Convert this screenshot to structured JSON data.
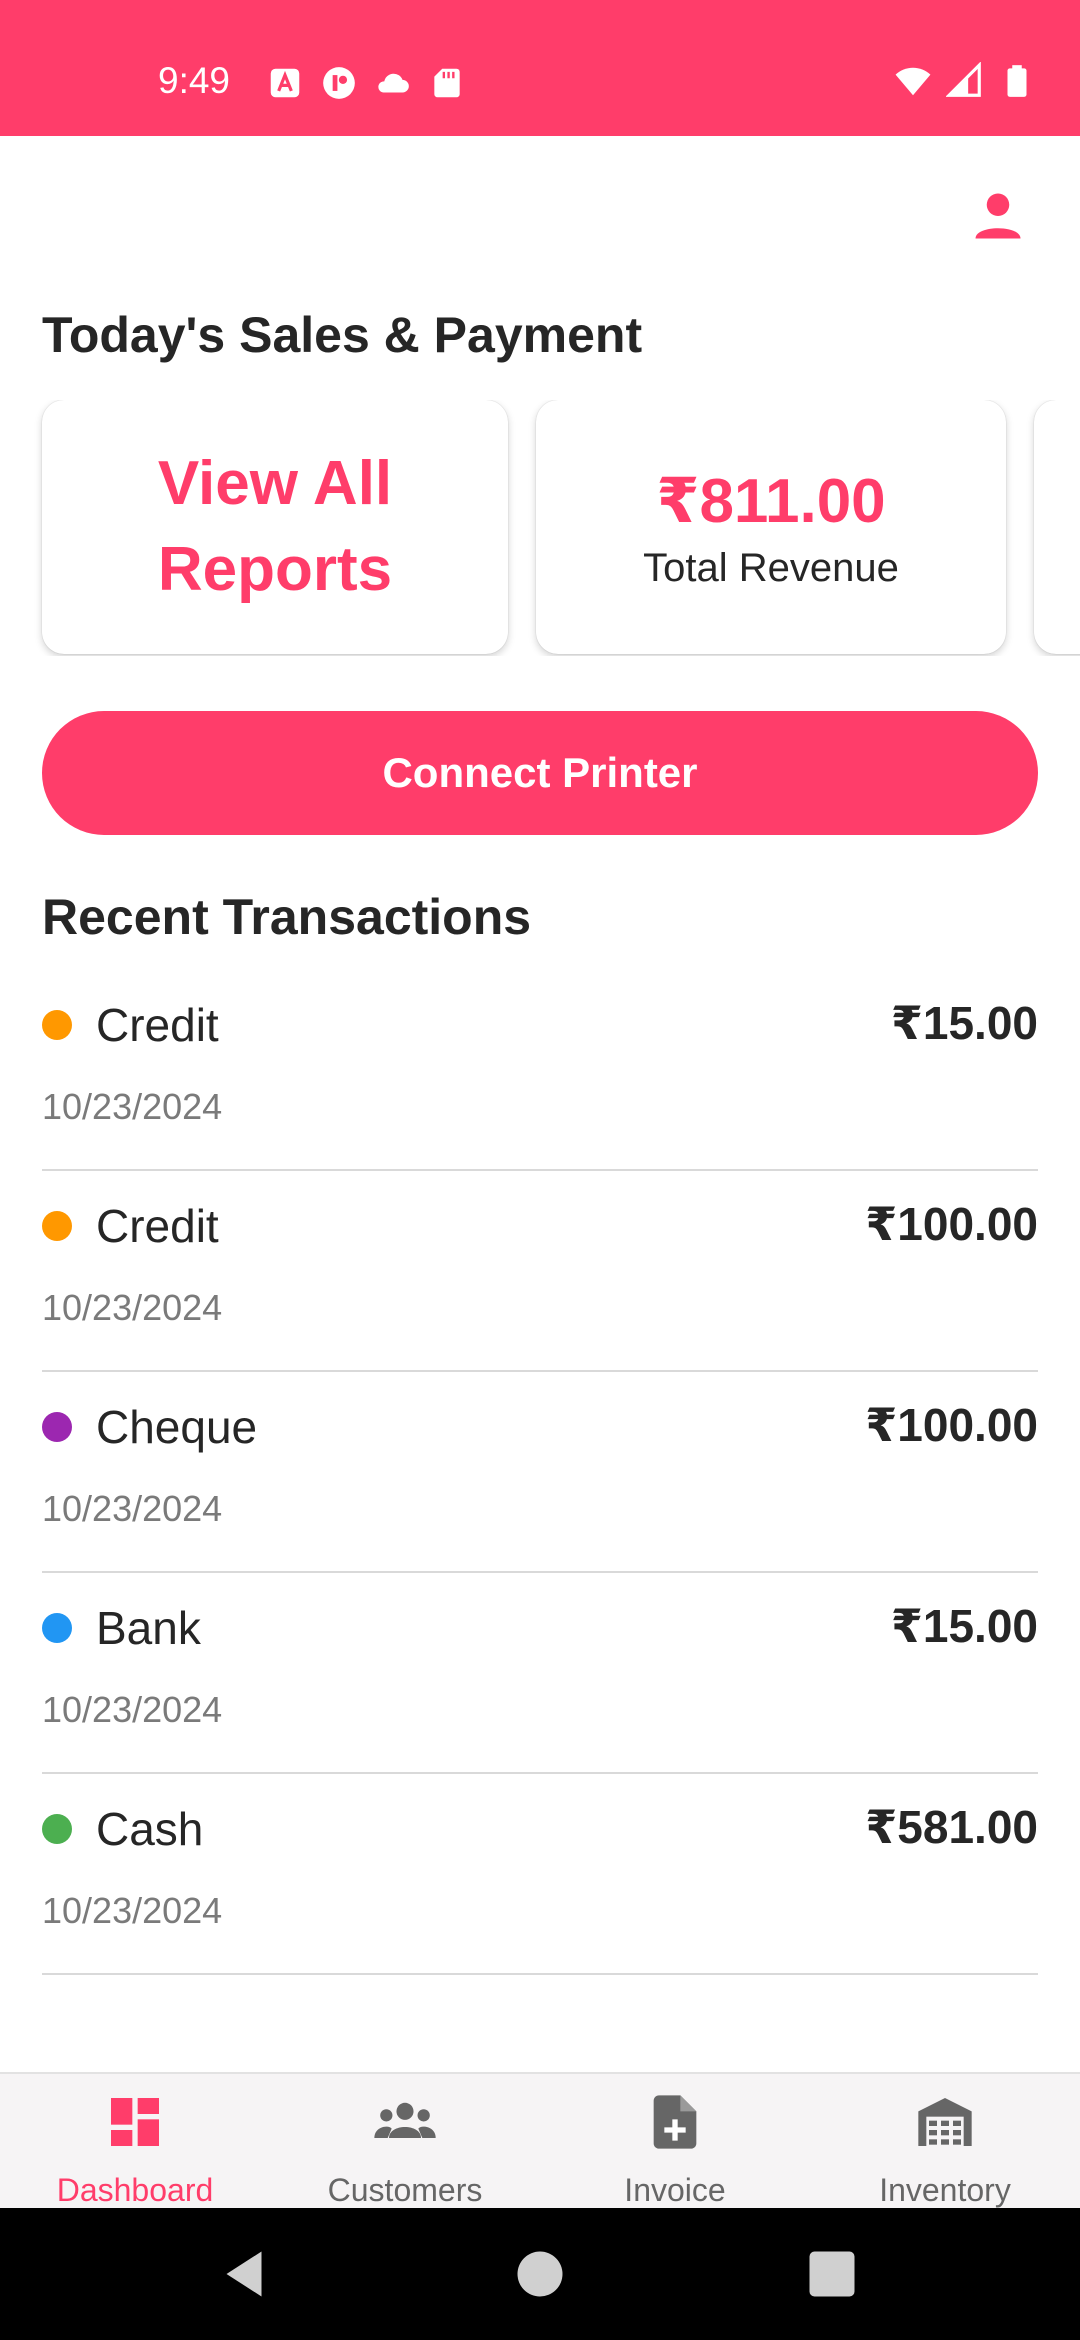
{
  "status_bar": {
    "time": "9:49",
    "left_icons": [
      "text-a-icon",
      "app-icon",
      "cloud-icon",
      "sd-card-icon"
    ],
    "right_icons": [
      "wifi-icon",
      "signal-icon",
      "battery-icon"
    ]
  },
  "header": {
    "profile_icon": "person-icon"
  },
  "sales": {
    "title": "Today's Sales & Payment",
    "reports_label": "View All Reports",
    "revenue_value": "₹811.00",
    "revenue_label": "Total Revenue"
  },
  "connect_printer_label": "Connect Printer",
  "transactions": {
    "title": "Recent Transactions",
    "items": [
      {
        "type": "Credit",
        "amount": "₹15.00",
        "date": "10/23/2024",
        "color": "#ff9800"
      },
      {
        "type": "Credit",
        "amount": "₹100.00",
        "date": "10/23/2024",
        "color": "#ff9800"
      },
      {
        "type": "Cheque",
        "amount": "₹100.00",
        "date": "10/23/2024",
        "color": "#9c27b0"
      },
      {
        "type": "Bank",
        "amount": "₹15.00",
        "date": "10/23/2024",
        "color": "#2196f3"
      },
      {
        "type": "Cash",
        "amount": "₹581.00",
        "date": "10/23/2024",
        "color": "#4caf50"
      }
    ]
  },
  "bottom_nav": {
    "items": [
      {
        "label": "Dashboard",
        "icon": "dashboard-icon",
        "active": true
      },
      {
        "label": "Customers",
        "icon": "customers-icon",
        "active": false
      },
      {
        "label": "Invoice",
        "icon": "invoice-icon",
        "active": false
      },
      {
        "label": "Inventory",
        "icon": "inventory-icon",
        "active": false
      }
    ]
  },
  "colors": {
    "accent": "#ff3d6a",
    "text": "#262626",
    "muted": "#7a7a7a",
    "nav_inactive": "#666666"
  }
}
